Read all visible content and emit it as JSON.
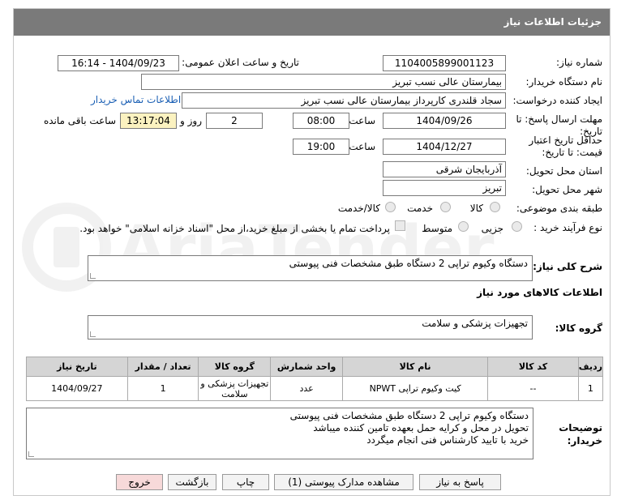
{
  "header": {
    "title": "جزئیات اطلاعات نیاز"
  },
  "form": {
    "need_number_label": "شماره نیاز:",
    "need_number": "1104005899001123",
    "announce_label": "تاریخ و ساعت اعلان عمومی:",
    "announce_value": "1404/09/23 - 16:14",
    "buyer_org_label": "نام دستگاه خریدار:",
    "buyer_org": "بیمارستان عالی نسب تبریز",
    "requester_label": "ایجاد کننده درخواست:",
    "requester": "سجاد قلندری کارپرداز بیمارستان عالی نسب تبریز",
    "contact_link": "اطلاعات تماس خریدار",
    "deadline_label": "مهلت ارسال پاسخ: تا تاریخ:",
    "deadline_date": "1404/09/26",
    "time_label": "ساعت",
    "deadline_time": "08:00",
    "days_value": "2",
    "days_label": "روز و",
    "remaining_time": "13:17:04",
    "remaining_label": "ساعت باقی مانده",
    "validity_label": "حداقل تاریخ اعتبار قیمت: تا تاریخ:",
    "validity_date": "1404/12/27",
    "validity_time": "19:00",
    "province_label": "استان محل تحویل:",
    "province": "آذربایجان شرقی",
    "city_label": "شهر محل تحویل:",
    "city": "تبریز",
    "category_label": "طبقه بندی موضوعی:",
    "category_options": [
      "کالا",
      "خدمت",
      "کالا/خدمت"
    ],
    "process_label": "نوع فرآیند خرید :",
    "process_options": [
      "جزیی",
      "متوسط"
    ],
    "payment_note": "پرداخت تمام یا بخشی از مبلغ خرید،از محل \"اسناد خزانه اسلامی\" خواهد بود."
  },
  "description": {
    "label": "شرح کلی نیاز:",
    "text": "دستگاه وکیوم تراپی  2 دستگاه طبق مشخصات فنی پیوستی"
  },
  "goods_section": {
    "title": "اطلاعات کالاهای مورد نیاز",
    "group_label": "گروه کالا:",
    "group_value": "تجهیزات پزشکی و سلامت"
  },
  "table": {
    "headers": [
      "ردیف",
      "کد کالا",
      "نام کالا",
      "واحد شمارش",
      "گروه کالا",
      "تعداد / مقدار",
      "تاریخ نیاز"
    ],
    "rows": [
      {
        "row": "1",
        "code": "--",
        "name": "کیت وکیوم تراپی NPWT",
        "unit": "عدد",
        "group": "تجهیزات پزشکی و سلامت",
        "qty": "1",
        "date": "1404/09/27"
      }
    ]
  },
  "buyer_notes": {
    "label": "توضیحات خریدار:",
    "lines": [
      "دستگاه وکیوم تراپی  2 دستگاه طبق مشخصات فنی پیوستی",
      "تحویل در محل و کرایه حمل بعهده تامین کننده میباشد",
      "خرید با تایید کارشناس فنی انجام میگردد"
    ]
  },
  "buttons": {
    "reply": "پاسخ به نیاز",
    "attachments": "مشاهده مدارک پیوستی (1)",
    "print": "چاپ",
    "back": "بازگشت",
    "exit": "خروج"
  },
  "watermark": {
    "text": "AriaTender.net"
  },
  "colors": {
    "titlebar": "#7a7a7a",
    "highlight": "#fbf2c0",
    "link": "#1a5fb4",
    "exit_button": "#f7d9d9"
  }
}
